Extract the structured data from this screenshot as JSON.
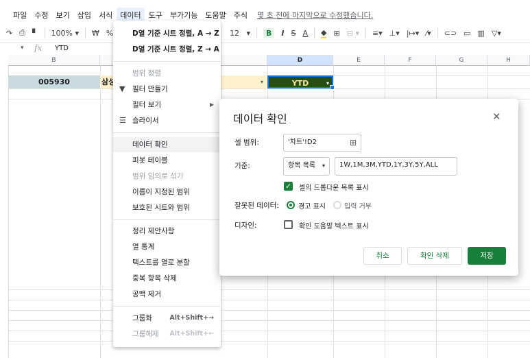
{
  "menubar": {
    "items": [
      "파일",
      "수정",
      "보기",
      "삽입",
      "서식",
      "데이터",
      "도구",
      "부가기능",
      "도움말",
      "주식"
    ],
    "last_edit": "몇 초 전에 마지막으로 수정했습니다."
  },
  "toolbar": {
    "zoom": "100%",
    "currency": "₩",
    "percent": "%",
    "font_size": "12",
    "bold": "B",
    "italic": "I",
    "strike": "S",
    "text_color": "A"
  },
  "formula_bar": {
    "fx": "fx",
    "value": "YTD"
  },
  "grid": {
    "columns": [
      "B",
      "D",
      "E",
      "F",
      "G",
      "H"
    ],
    "cell_b": "005930",
    "cell_c": "삼성",
    "cell_d": "YTD"
  },
  "data_menu": {
    "items": [
      {
        "label": "D열 기준 시트 정렬, A → Z"
      },
      {
        "label": "D열 기준 시트 정렬, Z → A"
      },
      {
        "label": "범위 정렬"
      },
      {
        "label": "필터 만들기"
      },
      {
        "label": "필터 보기"
      },
      {
        "label": "슬라이서"
      },
      {
        "label": "데이터 확인"
      },
      {
        "label": "피봇 테이블"
      },
      {
        "label": "범위 임의로 섞기"
      },
      {
        "label": "이름이 지정된 범위"
      },
      {
        "label": "보호된 시트와 범위"
      },
      {
        "label": "정리 제안사항"
      },
      {
        "label": "열 통계"
      },
      {
        "label": "텍스트를 열로 분할"
      },
      {
        "label": "중복 항목 삭제"
      },
      {
        "label": "공백 제거"
      },
      {
        "label": "그룹화",
        "shortcut": "Alt+Shift+→"
      },
      {
        "label": "그룹해제",
        "shortcut": "Alt+Shift+←"
      }
    ]
  },
  "dialog": {
    "title": "데이터 확인",
    "cell_range_label": "셀 범위:",
    "cell_range_value": "'차트'!D2",
    "criteria_label": "기준:",
    "criteria_type": "항목 목록",
    "criteria_value": "1W,1M,3M,YTD,1Y,3Y,5Y,ALL",
    "show_dropdown_label": "셀의 드롭다운 목록 표시",
    "invalid_label": "잘못된 데이터:",
    "warn_label": "경고 표시",
    "reject_label": "입력 거부",
    "appearance_label": "디자인:",
    "help_text_label": "확인 도움말 텍스트 표시",
    "cancel_label": "취소",
    "remove_label": "확인 삭제",
    "save_label": "저장"
  },
  "colors": {
    "accent_green": "#188038",
    "selection_blue": "#1a73e8",
    "cell_b_bg": "#c9dbe1",
    "cell_c_bg": "#fff2cc",
    "cell_d_bg": "#274e13"
  }
}
